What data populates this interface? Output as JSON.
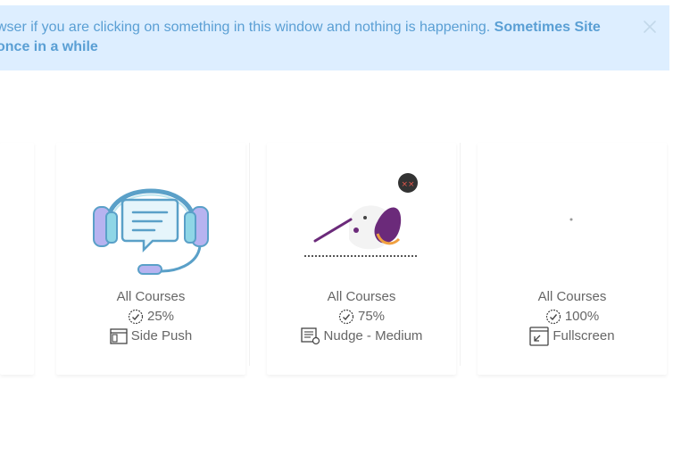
{
  "notice": {
    "line1_text": "wser if you are clicking on something in this window and nothing is happening. ",
    "line1_strong": "Sometimes Site",
    "line2_strong": "once in a while"
  },
  "cards": [
    {
      "category": "All Courses",
      "progress": "25%",
      "layout": "Side Push",
      "layout_icon": "side-push-icon",
      "image": "headset-support-icon"
    },
    {
      "category": "All Courses",
      "progress": "75%",
      "layout": "Nudge - Medium",
      "layout_icon": "nudge-icon",
      "image": "dragon-cartoon-image"
    },
    {
      "category": "All Courses",
      "progress": "100%",
      "layout": "Fullscreen",
      "layout_icon": "fullscreen-icon",
      "image": "loading-placeholder"
    }
  ],
  "colors": {
    "banner_bg": "#ddeeff",
    "banner_text": "#5a9fd4",
    "card_text": "#666666"
  }
}
